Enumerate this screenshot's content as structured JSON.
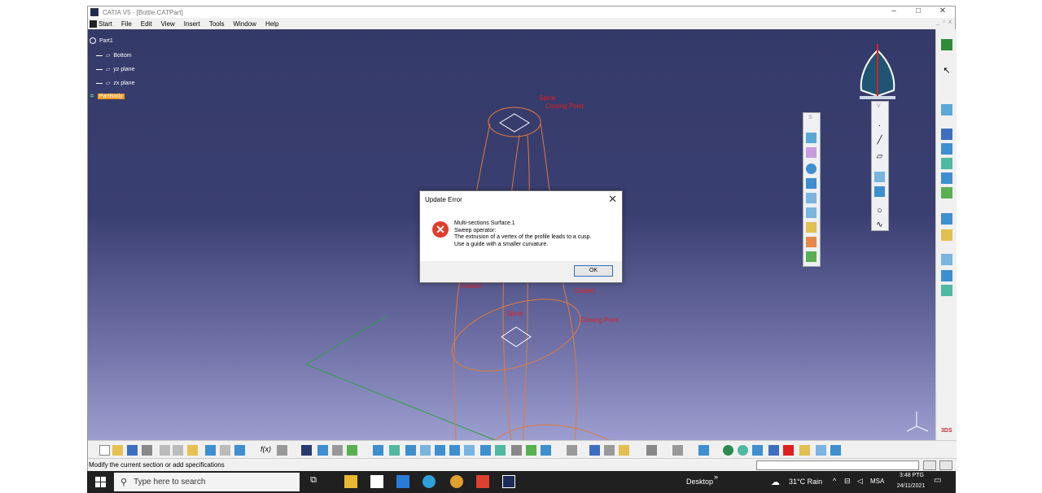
{
  "window": {
    "title": "CATIA V5 - [Bottle.CATPart]",
    "minimize": "–",
    "maximize": "□",
    "close": "✕"
  },
  "menu": [
    "Start",
    "File",
    "Edit",
    "View",
    "Insert",
    "Tools",
    "Window",
    "Help"
  ],
  "tree": {
    "root": "Part1",
    "items": [
      "Bottom",
      "yz plane",
      "zx plane"
    ],
    "selected": "PartBody"
  },
  "sketch_labels": [
    "Spine",
    "Closing Point",
    "Spine",
    "Closing Point",
    "Guide2",
    "Guide1"
  ],
  "floating_toolbars": [
    {
      "title": "S"
    },
    {
      "title": "V"
    }
  ],
  "dialog": {
    "title": "Update Error",
    "close": "✕",
    "message_lines": [
      "Multi-sections Surface.1",
      "Sweep operator:",
      "The extrusion of a vertex of the profile leads to a cusp.",
      "Use a guide with a smaller curvature."
    ],
    "ok": "OK"
  },
  "status_text": "Modify the current section or add specifications",
  "taskbar": {
    "search_placeholder": "Type here to search",
    "desktop": "Desktop",
    "chevron": "»",
    "weather": "31°C  Rain",
    "lang": "MSA",
    "time": "3:48 PTG",
    "date": "24/11/2021"
  },
  "colors": {
    "accent_orange": "#f39a21",
    "sketch_orange": "#e07a3c",
    "sketch_red": "#e02020",
    "axis_green": "#2ea043",
    "error_red": "#e23b2b",
    "bg_top": "#343a68",
    "bg_bottom": "#9c9ed0"
  }
}
